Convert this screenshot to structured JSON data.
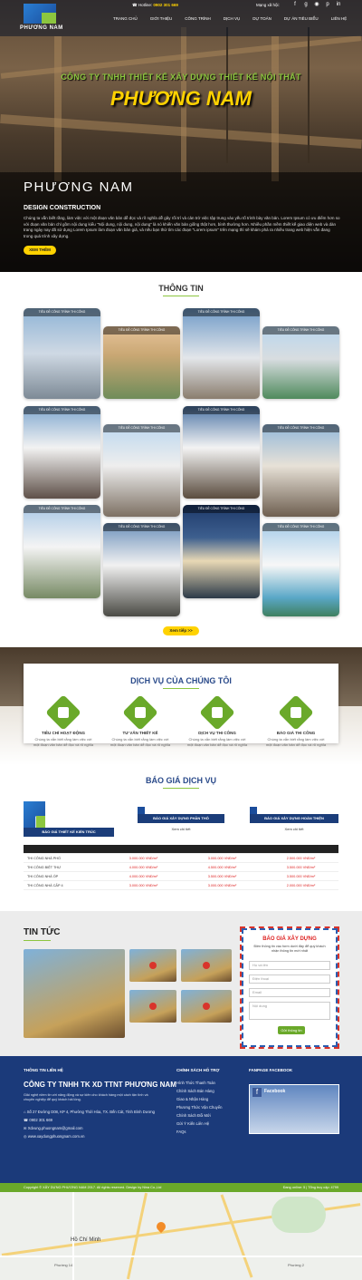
{
  "brand": {
    "logo_text": "PHƯƠNG NAM",
    "colors": {
      "primary": "#1b3a7a",
      "accent": "#8cc63f",
      "highlight": "#ffd200",
      "red": "#d22"
    }
  },
  "topbar": {
    "hotline_label": "Hotline:",
    "hotline": "0902 301 669",
    "social_label": "Mạng xã hội:",
    "social_icons": [
      "facebook-icon",
      "google-plus-icon",
      "rss-icon",
      "pinterest-icon",
      "linkedin-icon"
    ]
  },
  "nav": [
    "TRANG CHỦ",
    "GIỚI THIỆU",
    "CÔNG TRÌNH",
    "DỊCH VỤ",
    "DỰ TOÁN",
    "DỰ ÁN TIÊU BIỂU",
    "LIÊN HỆ"
  ],
  "hero": {
    "subtitle": "CÔNG TY TNHH THIẾT KẾ XÂY DỰNG THIẾT KẾ NỘI THẤT",
    "title": "PHƯƠNG NAM",
    "panel_title": "PHƯƠNG   NAM",
    "panel_sub": "DESIGN CONSTRUCTION",
    "panel_desc": "Chúng ta vẫn biết rằng, làm việc với một đoạn văn bản dễ đọc và rõ nghĩa dễ gây rối trí và cản trở việc tập trung vào yếu tố trình bày văn bản. Lorem Ipsum có ưu điểm hơn so với đoạn văn bản chỉ gồm nội dung kiểu \"Nội dung, nội dung, nội dung\" là nó khiến văn bản giống thật hơn, bình thường hơn. Nhiều phần mềm thiết kế giao diện web và dàn trang ngày nay đã sử dụng Lorem Ipsum làm đoạn văn bản giả, và nếu bạn thử tìm các đoạn \"Lorem ipsum\" trên mạng thì sẽ khám phá ra nhiều trang web hiện vẫn đang trong quá trình xây dựng.",
    "btn": "XEM THÊM"
  },
  "info": {
    "title": "THÔNG TIN",
    "card_caption": "TIÊU ĐỀ CÔNG TRÌNH THI CÔNG",
    "more_btn": "Xem tiếp >>"
  },
  "services": {
    "title": "DỊCH VỤ CỦA CHÚNG TÔI",
    "items": [
      {
        "name": "TIÊU CHÍ HOẠT ĐỘNG",
        "desc": "Chúng ta vẫn biết rằng làm việc với một đoạn văn bản dễ đọc và rõ nghĩa",
        "icon": "tools-icon"
      },
      {
        "name": "TƯ VẤN THIẾT KẾ",
        "desc": "Chúng ta vẫn biết rằng làm việc với một đoạn văn bản dễ đọc và rõ nghĩa",
        "icon": "engineer-icon"
      },
      {
        "name": "DỊCH VỤ THI CÔNG",
        "desc": "Chúng ta vẫn biết rằng làm việc với một đoạn văn bản dễ đọc và rõ nghĩa",
        "icon": "document-icon"
      },
      {
        "name": "BÁO GIÁ THI CÔNG",
        "desc": "Chúng ta vẫn biết rằng làm việc với một đoạn văn bản dễ đọc và rõ nghĩa",
        "icon": "money-icon"
      }
    ]
  },
  "pricing": {
    "title": "BÁO GIÁ DỊCH VỤ",
    "heads": [
      "BÁO GIÁ THIẾT KẾ KIẾN TRÚC",
      "BÁO GIÁ XÂY DỰNG PHẦN THÔ",
      "BÁO GIÁ XÂY DỰNG HOÀN THIỆN"
    ],
    "detail": "Xem chi tiết",
    "rows": [
      {
        "name": "THI CÔNG NHÀ PHỐ",
        "a": "3.000.000 VNĐ/m²",
        "b": "3.000.000 VNĐ/m²",
        "c": "2.500.000 VNĐ/m²"
      },
      {
        "name": "THI CÔNG BIỆT THỰ",
        "a": "4.000.000 VNĐ/m²",
        "b": "4.500.000 VNĐ/m²",
        "c": "3.500.000 VNĐ/m²"
      },
      {
        "name": "THI CÔNG NHÀ ỐP",
        "a": "4.000.000 VNĐ/m²",
        "b": "3.500.000 VNĐ/m²",
        "c": "3.500.000 VNĐ/m²"
      },
      {
        "name": "THI CÔNG NHÀ CẤP 4",
        "a": "3.000.000 VNĐ/m²",
        "b": "3.000.000 VNĐ/m²",
        "c": "2.000.000 VNĐ/m²"
      }
    ]
  },
  "news": {
    "title": "TIN TỨC"
  },
  "quote_form": {
    "title": "BÁO GIÁ XÂY DỰNG",
    "desc": "Điền thông tin vào form dưới đây để quý khách nhận thông tin mới nhất",
    "fields": [
      "Họ và tên",
      "Điện thoại",
      "Email",
      "Nội dung"
    ],
    "submit": "Gửi thông tin"
  },
  "footer": {
    "contact_head": "THÔNG TIN LIÊN HỆ",
    "company": "CÔNG TY TNHH TK XD TTNT PHƯƠNG NAM",
    "tagline": "Giải nghệ niềm tin với năng động và sự kiên cho khách hàng một cách tận tình và chuyên nghiệp để quý khách hài lòng.",
    "address": "Số 27 Đường D08, KP 4, Phường Thới Hòa, TX. Bến Cát, Tỉnh Bình Dương",
    "phone": "0902 301 669",
    "email": "Xdvung.phuongnam@gmail.com",
    "website": "www.xaydungphuongnam.com.vn",
    "policy_head": "CHÍNH SÁCH HỖ TRỢ",
    "policies": [
      "Hình Thức Thanh Toán",
      "Chính Sách Bán Hàng",
      "Giao & Nhận Hàng",
      "Phương Thức Vận Chuyển",
      "Chính Sách Đổi Mới",
      "Gửi Ý Kiến Liên Hệ",
      "FAQs"
    ],
    "fanpage_head": "FANPAGE FACEBOOK",
    "fanpage_name": "Facebook",
    "copyright": "Copyright © XÂY DỰNG PHƯƠNG NAM 2017. All rights reserved. Design by Nina Co.,Ltd",
    "stats": "Đang online: 5 | Tổng truy cập: 4799"
  },
  "map": {
    "labels": [
      "Hồ Chí Minh",
      "Phường 14",
      "Phường 2"
    ]
  }
}
